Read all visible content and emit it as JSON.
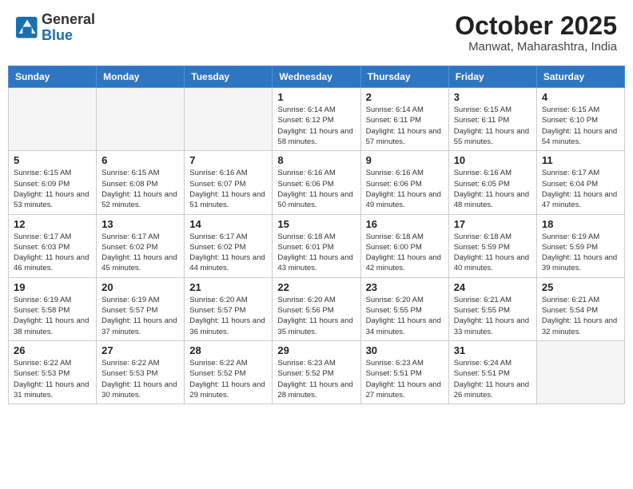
{
  "header": {
    "logo_line1": "General",
    "logo_line2": "Blue",
    "month": "October 2025",
    "location": "Manwat, Maharashtra, India"
  },
  "weekdays": [
    "Sunday",
    "Monday",
    "Tuesday",
    "Wednesday",
    "Thursday",
    "Friday",
    "Saturday"
  ],
  "weeks": [
    [
      {
        "day": "",
        "info": ""
      },
      {
        "day": "",
        "info": ""
      },
      {
        "day": "",
        "info": ""
      },
      {
        "day": "1",
        "info": "Sunrise: 6:14 AM\nSunset: 6:12 PM\nDaylight: 11 hours\nand 58 minutes."
      },
      {
        "day": "2",
        "info": "Sunrise: 6:14 AM\nSunset: 6:11 PM\nDaylight: 11 hours\nand 57 minutes."
      },
      {
        "day": "3",
        "info": "Sunrise: 6:15 AM\nSunset: 6:11 PM\nDaylight: 11 hours\nand 55 minutes."
      },
      {
        "day": "4",
        "info": "Sunrise: 6:15 AM\nSunset: 6:10 PM\nDaylight: 11 hours\nand 54 minutes."
      }
    ],
    [
      {
        "day": "5",
        "info": "Sunrise: 6:15 AM\nSunset: 6:09 PM\nDaylight: 11 hours\nand 53 minutes."
      },
      {
        "day": "6",
        "info": "Sunrise: 6:15 AM\nSunset: 6:08 PM\nDaylight: 11 hours\nand 52 minutes."
      },
      {
        "day": "7",
        "info": "Sunrise: 6:16 AM\nSunset: 6:07 PM\nDaylight: 11 hours\nand 51 minutes."
      },
      {
        "day": "8",
        "info": "Sunrise: 6:16 AM\nSunset: 6:06 PM\nDaylight: 11 hours\nand 50 minutes."
      },
      {
        "day": "9",
        "info": "Sunrise: 6:16 AM\nSunset: 6:06 PM\nDaylight: 11 hours\nand 49 minutes."
      },
      {
        "day": "10",
        "info": "Sunrise: 6:16 AM\nSunset: 6:05 PM\nDaylight: 11 hours\nand 48 minutes."
      },
      {
        "day": "11",
        "info": "Sunrise: 6:17 AM\nSunset: 6:04 PM\nDaylight: 11 hours\nand 47 minutes."
      }
    ],
    [
      {
        "day": "12",
        "info": "Sunrise: 6:17 AM\nSunset: 6:03 PM\nDaylight: 11 hours\nand 46 minutes."
      },
      {
        "day": "13",
        "info": "Sunrise: 6:17 AM\nSunset: 6:02 PM\nDaylight: 11 hours\nand 45 minutes."
      },
      {
        "day": "14",
        "info": "Sunrise: 6:17 AM\nSunset: 6:02 PM\nDaylight: 11 hours\nand 44 minutes."
      },
      {
        "day": "15",
        "info": "Sunrise: 6:18 AM\nSunset: 6:01 PM\nDaylight: 11 hours\nand 43 minutes."
      },
      {
        "day": "16",
        "info": "Sunrise: 6:18 AM\nSunset: 6:00 PM\nDaylight: 11 hours\nand 42 minutes."
      },
      {
        "day": "17",
        "info": "Sunrise: 6:18 AM\nSunset: 5:59 PM\nDaylight: 11 hours\nand 40 minutes."
      },
      {
        "day": "18",
        "info": "Sunrise: 6:19 AM\nSunset: 5:59 PM\nDaylight: 11 hours\nand 39 minutes."
      }
    ],
    [
      {
        "day": "19",
        "info": "Sunrise: 6:19 AM\nSunset: 5:58 PM\nDaylight: 11 hours\nand 38 minutes."
      },
      {
        "day": "20",
        "info": "Sunrise: 6:19 AM\nSunset: 5:57 PM\nDaylight: 11 hours\nand 37 minutes."
      },
      {
        "day": "21",
        "info": "Sunrise: 6:20 AM\nSunset: 5:57 PM\nDaylight: 11 hours\nand 36 minutes."
      },
      {
        "day": "22",
        "info": "Sunrise: 6:20 AM\nSunset: 5:56 PM\nDaylight: 11 hours\nand 35 minutes."
      },
      {
        "day": "23",
        "info": "Sunrise: 6:20 AM\nSunset: 5:55 PM\nDaylight: 11 hours\nand 34 minutes."
      },
      {
        "day": "24",
        "info": "Sunrise: 6:21 AM\nSunset: 5:55 PM\nDaylight: 11 hours\nand 33 minutes."
      },
      {
        "day": "25",
        "info": "Sunrise: 6:21 AM\nSunset: 5:54 PM\nDaylight: 11 hours\nand 32 minutes."
      }
    ],
    [
      {
        "day": "26",
        "info": "Sunrise: 6:22 AM\nSunset: 5:53 PM\nDaylight: 11 hours\nand 31 minutes."
      },
      {
        "day": "27",
        "info": "Sunrise: 6:22 AM\nSunset: 5:53 PM\nDaylight: 11 hours\nand 30 minutes."
      },
      {
        "day": "28",
        "info": "Sunrise: 6:22 AM\nSunset: 5:52 PM\nDaylight: 11 hours\nand 29 minutes."
      },
      {
        "day": "29",
        "info": "Sunrise: 6:23 AM\nSunset: 5:52 PM\nDaylight: 11 hours\nand 28 minutes."
      },
      {
        "day": "30",
        "info": "Sunrise: 6:23 AM\nSunset: 5:51 PM\nDaylight: 11 hours\nand 27 minutes."
      },
      {
        "day": "31",
        "info": "Sunrise: 6:24 AM\nSunset: 5:51 PM\nDaylight: 11 hours\nand 26 minutes."
      },
      {
        "day": "",
        "info": ""
      }
    ]
  ]
}
